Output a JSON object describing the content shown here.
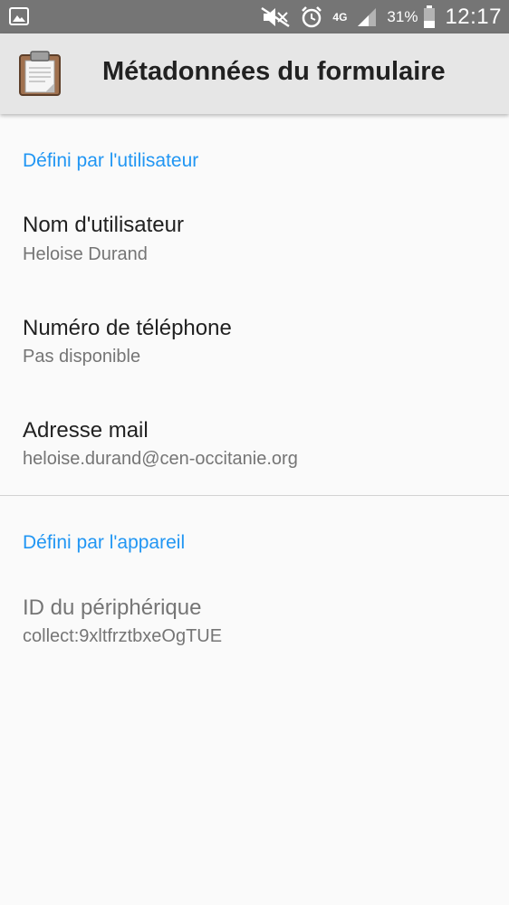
{
  "status_bar": {
    "network_label": "4G",
    "battery_percent": "31%",
    "time": "12:17",
    "icons": [
      "image-notification-icon",
      "mute-icon",
      "alarm-icon",
      "signal-icon",
      "battery-icon"
    ]
  },
  "app_bar": {
    "title": "Métadonnées du formulaire",
    "icon": "clipboard-icon"
  },
  "sections": {
    "user": {
      "header": "Défini par l'utilisateur",
      "items": [
        {
          "title": "Nom d'utilisateur",
          "summary": "Heloise Durand"
        },
        {
          "title": "Numéro de téléphone",
          "summary": "Pas disponible"
        },
        {
          "title": "Adresse mail",
          "summary": "heloise.durand@cen-occitanie.org"
        }
      ]
    },
    "device": {
      "header": "Défini par l'appareil",
      "items": [
        {
          "title": "ID du périphérique",
          "summary": "collect:9xltfrztbxeOgTUE"
        }
      ]
    }
  },
  "colors": {
    "status_bar": "#757575",
    "app_bar": "#e6e6e6",
    "accent": "#2196f3",
    "background": "#fafafa"
  }
}
